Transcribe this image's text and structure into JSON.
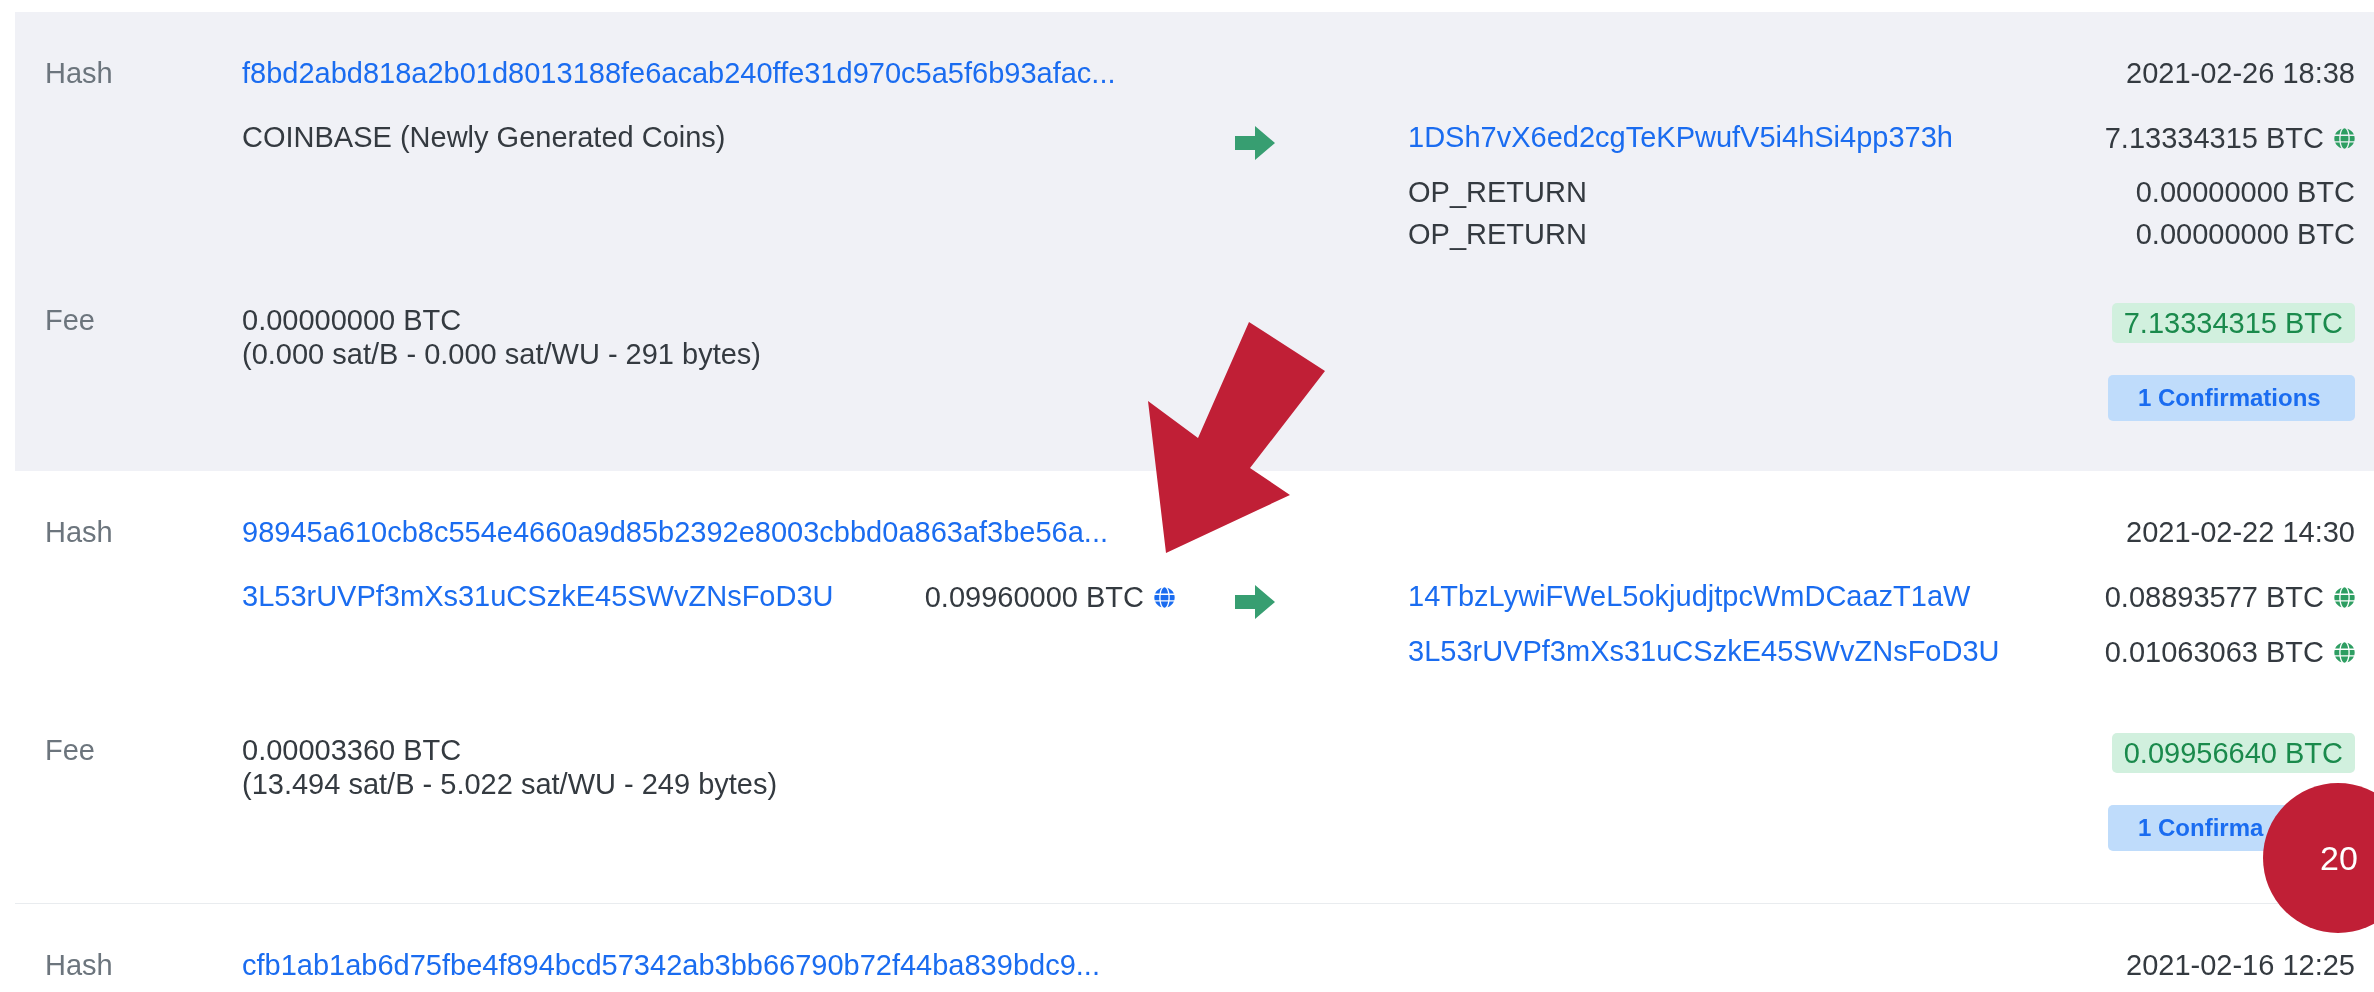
{
  "transactions": [
    {
      "highlighted": true,
      "hash_label": "Hash",
      "hash": "f8bd2abd818a2b01d8013188fe6acab240ffe31d970c5a5f6b93afac...",
      "time": "2021-02-26 18:38",
      "inputs": [
        {
          "kind": "coinbase",
          "text": "COINBASE (Newly Generated Coins)"
        }
      ],
      "outputs": [
        {
          "kind": "address",
          "address": "1DSh7vX6ed2cgTeKPwufV5i4hSi4pp373h",
          "amount": "7.13334315 BTC"
        },
        {
          "kind": "script",
          "address": "OP_RETURN",
          "amount": "0.00000000 BTC"
        },
        {
          "kind": "script",
          "address": "OP_RETURN",
          "amount": "0.00000000 BTC"
        }
      ],
      "fee_label": "Fee",
      "fee": "0.00000000 BTC",
      "fee_details": "(0.000 sat/B - 0.000 sat/WU - 291 bytes)",
      "total": "7.13334315 BTC",
      "confirmations": "1 Confirmations"
    },
    {
      "highlighted": false,
      "hash_label": "Hash",
      "hash": "98945a610cb8c554e4660a9d85b2392e8003cbbd0a863af3be56a...",
      "time": "2021-02-22 14:30",
      "inputs": [
        {
          "kind": "address",
          "text": "3L53rUVPf3mXs31uCSzkE45SWvZNsFoD3U",
          "amount": "0.09960000 BTC"
        }
      ],
      "outputs": [
        {
          "kind": "address",
          "address": "14TbzLywiFWeL5okjudjtpcWmDCaazT1aW",
          "amount": "0.08893577 BTC"
        },
        {
          "kind": "address",
          "address": "3L53rUVPf3mXs31uCSzkE45SWvZNsFoD3U",
          "amount": "0.01063063 BTC"
        }
      ],
      "fee_label": "Fee",
      "fee": "0.00003360 BTC",
      "fee_details": "(13.494 sat/B - 5.022 sat/WU - 249 bytes)",
      "total": "0.09956640 BTC",
      "confirmations": "1 Confirma"
    },
    {
      "highlighted": false,
      "hash_label": "Hash",
      "hash": "cfb1ab1ab6d75fbe4f894bcd57342ab3bb66790b72f44ba839bdc9...",
      "time": "2021-02-16 12:25"
    }
  ],
  "annotation": {
    "marker": "20"
  }
}
